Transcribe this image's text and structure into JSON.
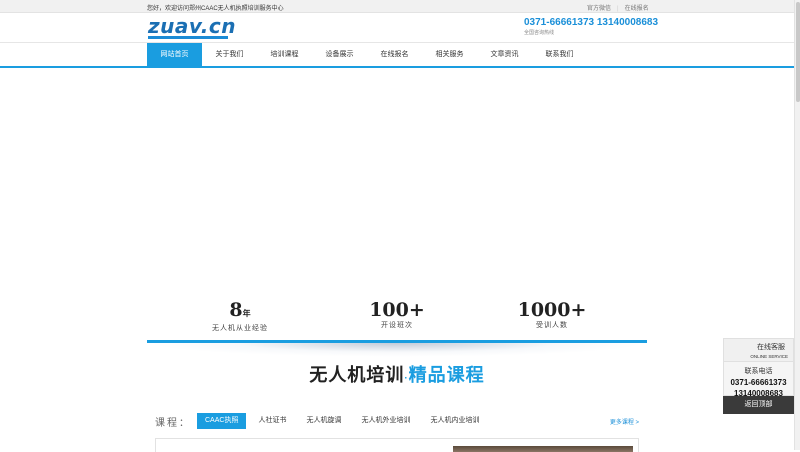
{
  "topbar": {
    "welcome": "您好，欢迎访问郑州CAAC无人机执照培训服务中心",
    "links": [
      "官方微信",
      "在线报名"
    ]
  },
  "header": {
    "logo": "zuav.cn",
    "phone": "0371-66661373 13140008683",
    "phone_sub": "全国咨询热线"
  },
  "nav": {
    "items": [
      "网站首页",
      "关于我们",
      "培训课程",
      "设备展示",
      "在线报名",
      "相关服务",
      "文章资讯",
      "联系我们"
    ],
    "active": 0
  },
  "stats": [
    {
      "value": "8",
      "unit": "年",
      "label": "无人机从业经验"
    },
    {
      "value": "100+",
      "unit": "",
      "label": "开设班次"
    },
    {
      "value": "1000+",
      "unit": "",
      "label": "受训人数"
    }
  ],
  "section": {
    "title_a": "无人机培训",
    "dot": "·",
    "title_b": "精品课程"
  },
  "courses": {
    "label": "课程：",
    "tabs": [
      "CAAC执照",
      "人社证书",
      "无人机旋调",
      "无人机外业培训",
      "无人机内业培训"
    ],
    "active": 0,
    "more": "更多课程 >"
  },
  "float_panel": {
    "service_title": "在线客服",
    "service_sub": "ONLINE SERVICE",
    "phone_title": "联系电话",
    "phone_1": "0371-66661373",
    "phone_2": "13140008683",
    "back_top": "返回顶部"
  },
  "colors": {
    "accent": "#1a9de0",
    "phone": "#1a8fd8"
  }
}
